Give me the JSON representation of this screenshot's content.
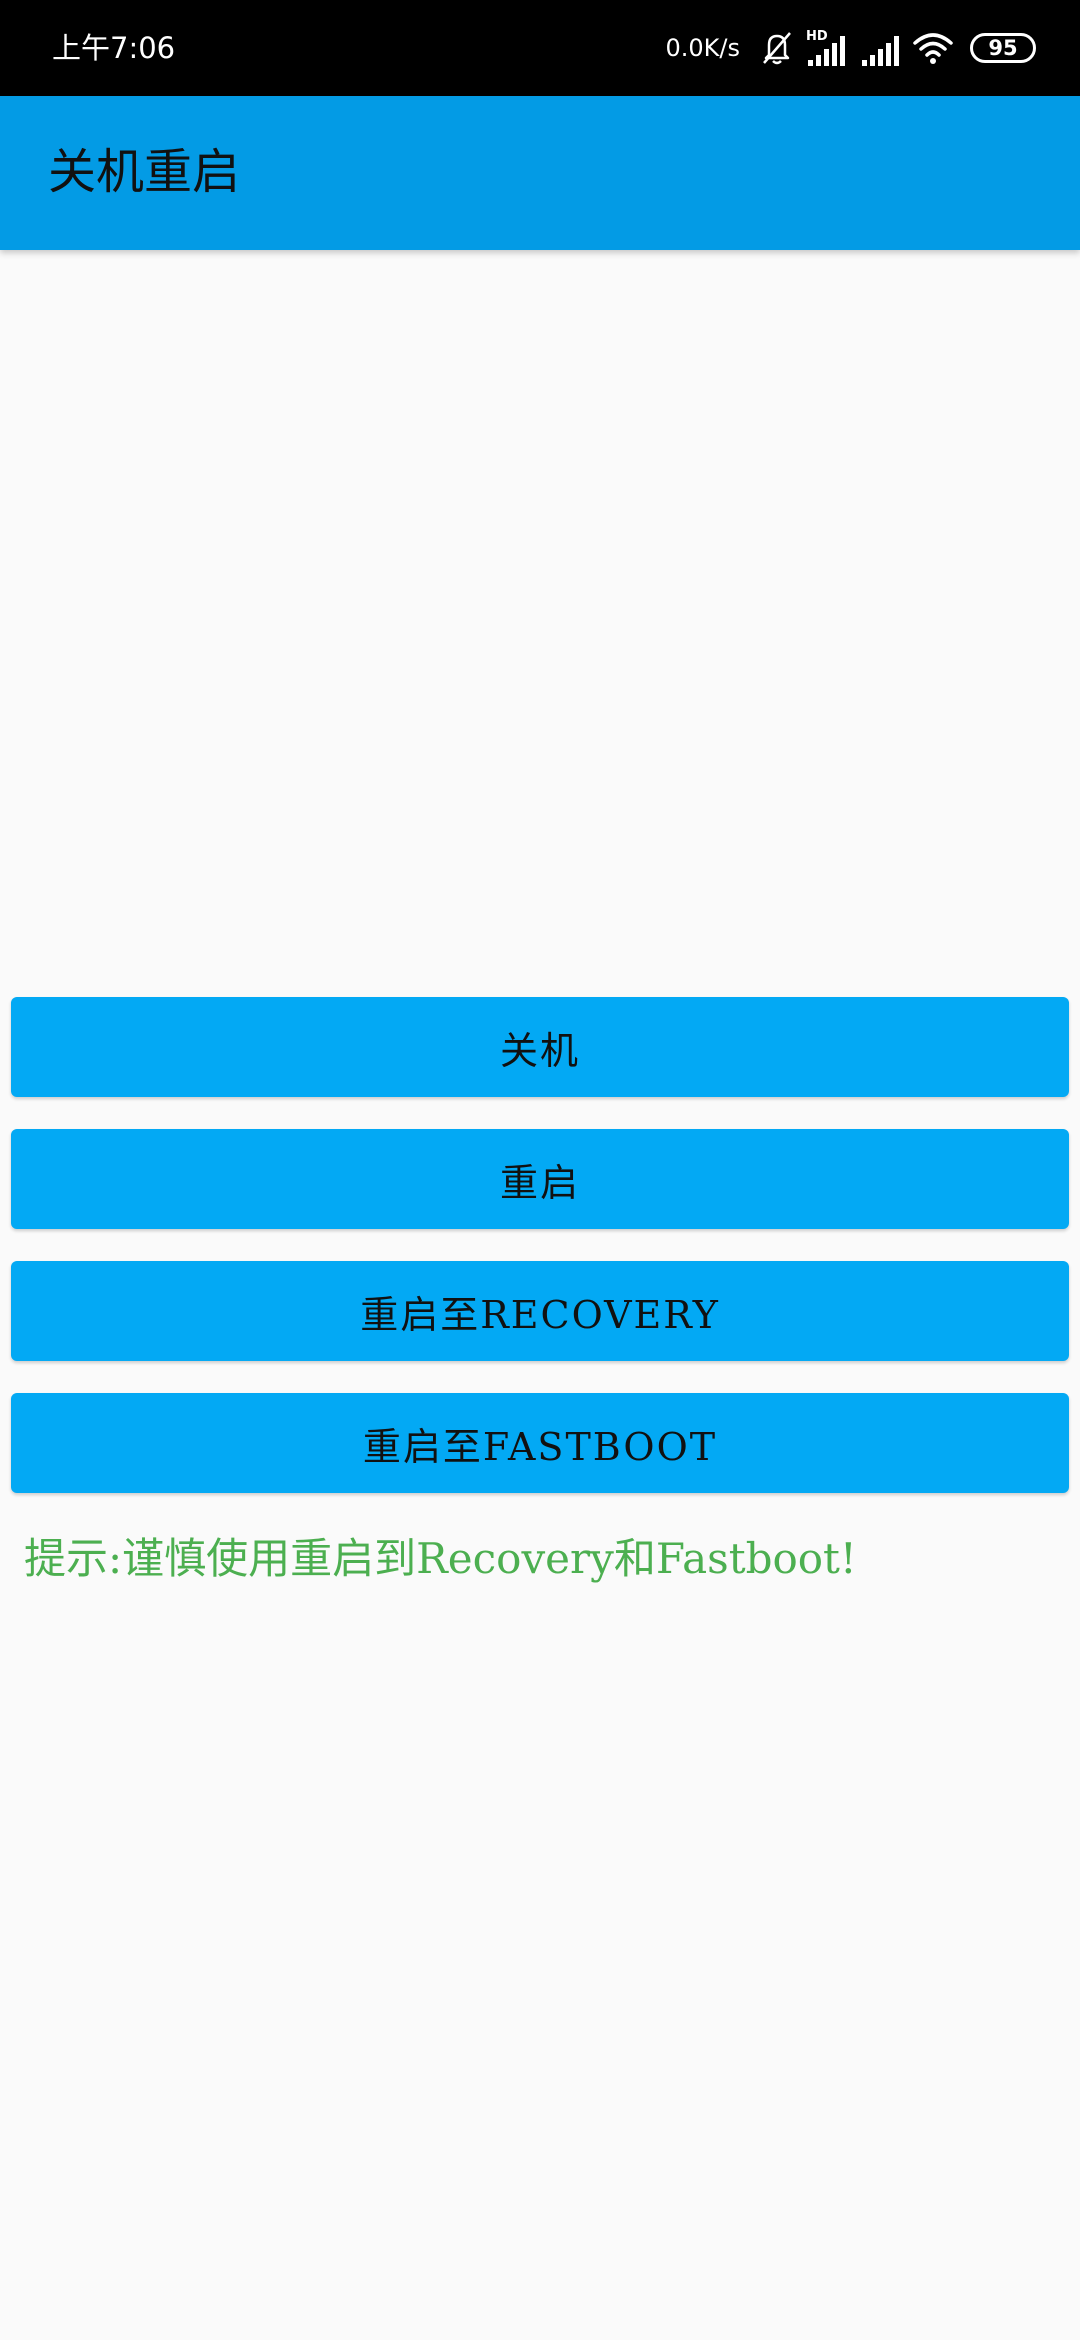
{
  "status_bar": {
    "time": "上午7:06",
    "net_speed": "0.0K/s",
    "network_label": "HD",
    "battery": "95",
    "icons": [
      "bell-off-icon",
      "signal-hd-icon",
      "signal-icon",
      "wifi-icon",
      "battery-icon"
    ]
  },
  "app_bar": {
    "title": "关机重启",
    "color": "#039be5"
  },
  "buttons": {
    "shutdown": "关机",
    "reboot": "重启",
    "reboot_recovery": "重启至RECOVERY",
    "reboot_fastboot": "重启至FASTBOOT",
    "color": "#03a9f4"
  },
  "hint": {
    "text": "提示:谨慎使用重启到Recovery和Fastboot!",
    "color": "#4caf50"
  }
}
